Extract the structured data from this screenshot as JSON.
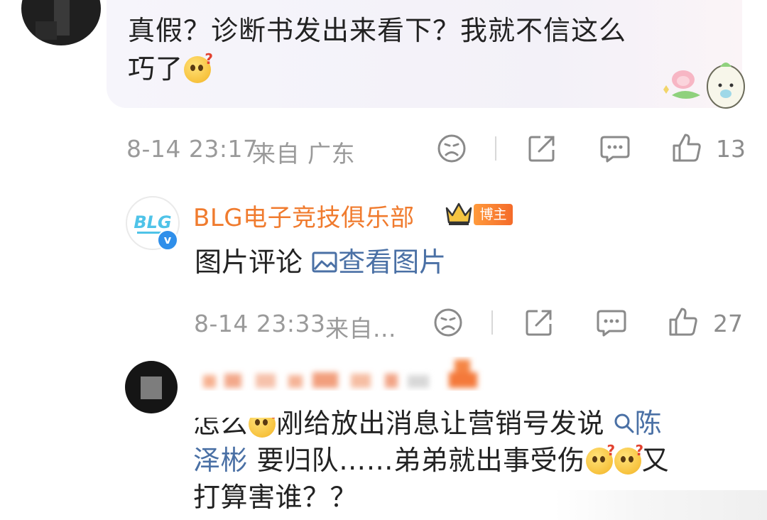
{
  "comments": [
    {
      "text_line1": "真假？诊断书发出来看下？我就不信这么",
      "text_line2": "巧了",
      "timestamp": "8-14 23:17",
      "location": "来自 广东",
      "like_count": "13"
    },
    {
      "author": "BLG电子竞技俱乐部",
      "avatar_text": "BLG",
      "badge": "博主",
      "verified_mark": "v",
      "text_prefix": "图片评论",
      "link_label": "查看图片",
      "timestamp": "8-14 23:33",
      "location": "来自...",
      "like_count": "27"
    },
    {
      "text_part1": "怎么",
      "text_part2": "刚给放出消息让营销号发说",
      "topic_line1": "陈",
      "topic_line2": "泽彬",
      "text_part3": " 要归队……弟弟就出事受伤",
      "text_part4": "又",
      "text_line4": "打算害谁？？"
    }
  ],
  "emoji_mark": "?",
  "icons": [
    "dislike-face-icon",
    "share-icon",
    "comment-icon",
    "like-thumb-icon",
    "image-icon",
    "search-icon",
    "crown-icon"
  ],
  "colors": {
    "accent_orange": "#f07b2e",
    "link_blue": "#4a70a5",
    "meta_gray": "#9a9a9a",
    "verified_blue": "#2f8fea"
  }
}
